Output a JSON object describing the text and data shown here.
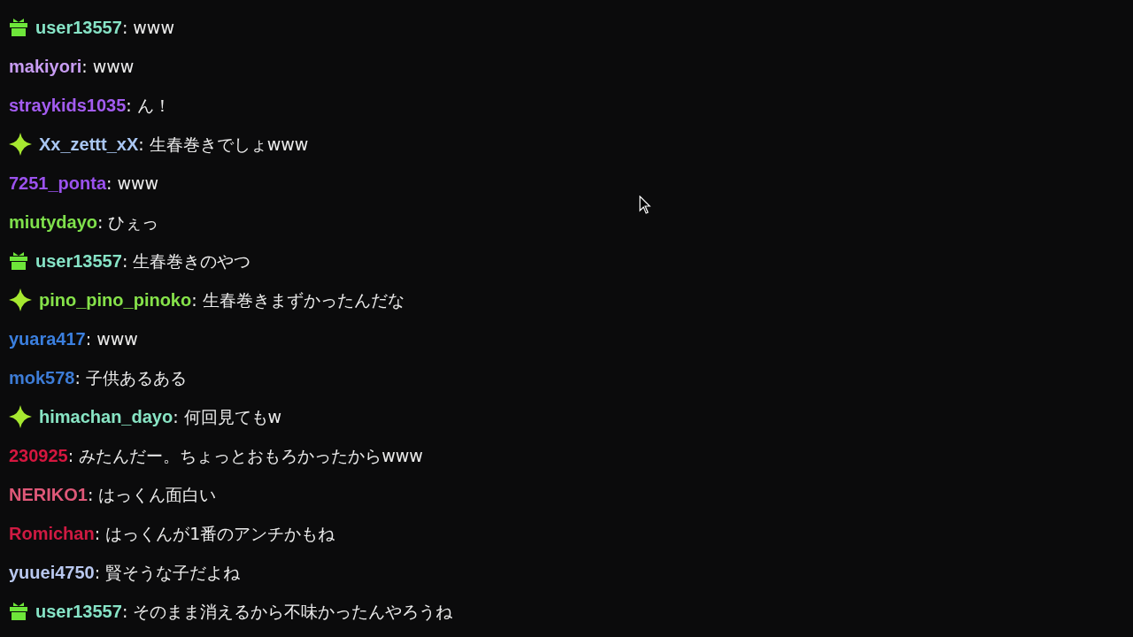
{
  "messages": [
    {
      "kind": "gift",
      "user": "user13557",
      "color": "#86e3c6",
      "text": ": www"
    },
    {
      "kind": "plain",
      "user": "makiyori",
      "color": "#c79cf2",
      "text": ": www"
    },
    {
      "kind": "plain",
      "user": "straykids1035",
      "color": "#a35cf0",
      "text": ": ん！"
    },
    {
      "kind": "sparkle",
      "user": "Xx_zettt_xX",
      "color": "#a9c6f2",
      "text": ": 生春巻きでしょwww"
    },
    {
      "kind": "plain",
      "user": "7251_ponta",
      "color": "#9b52ee",
      "text": ": www"
    },
    {
      "kind": "plain",
      "user": "miutydayo",
      "color": "#7fe04c",
      "text": ": ひぇっ"
    },
    {
      "kind": "gift",
      "user": "user13557",
      "color": "#86e3c6",
      "text": ": 生春巻きのやつ"
    },
    {
      "kind": "sparkle",
      "user": "pino_pino_pinoko",
      "color": "#86e24a",
      "text": ": 生春巻きまずかったんだな"
    },
    {
      "kind": "plain",
      "user": "yuara417",
      "color": "#3b7fde",
      "text": ": www"
    },
    {
      "kind": "plain",
      "user": "mok578",
      "color": "#3d7cd6",
      "text": ": 子供あるある"
    },
    {
      "kind": "sparkle",
      "user": "himachan_dayo",
      "color": "#88e4c4",
      "text": ": 何回見てもw"
    },
    {
      "kind": "plain",
      "user": "230925",
      "color": "#d4173f",
      "text": ": みたんだー。ちょっとおもろかったからwww"
    },
    {
      "kind": "plain",
      "user": "NERIKO1",
      "color": "#df5878",
      "text": ": はっくん面白い"
    },
    {
      "kind": "plain",
      "user": "Romichan",
      "color": "#cf1a42",
      "text": ": はっくんが1番のアンチかもね"
    },
    {
      "kind": "plain",
      "user": "yuuei4750",
      "color": "#b9c8ef",
      "text": ": 賢そうな子だよね"
    },
    {
      "kind": "gift",
      "user": "user13557",
      "color": "#86e3c6",
      "text": ": そのまま消えるから不味かったんやろうね"
    }
  ]
}
